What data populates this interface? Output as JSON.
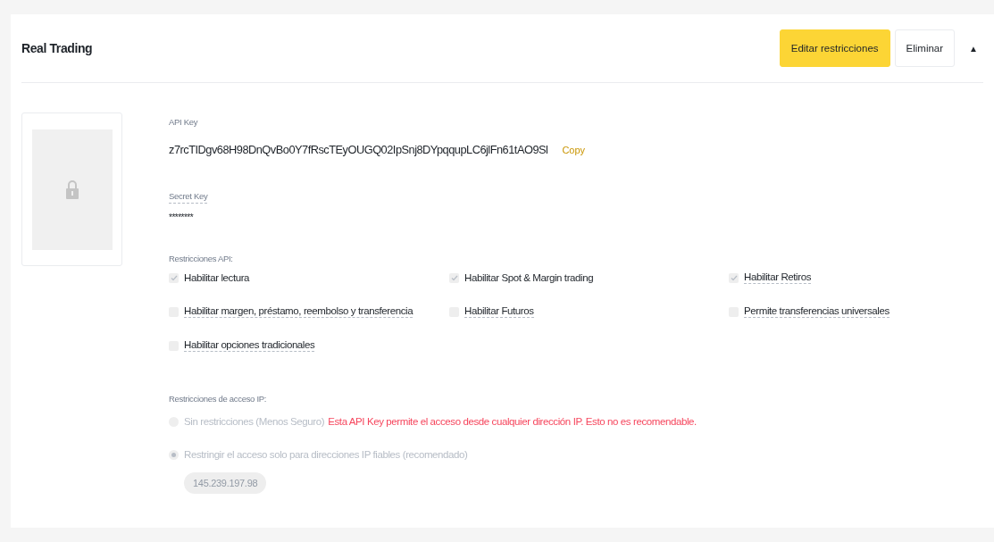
{
  "card": {
    "title": "Real Trading",
    "buttons": [
      {
        "label": "Editar restricciones",
        "kind": "primary"
      },
      {
        "label": "Eliminar",
        "kind": "secondary"
      }
    ],
    "toggle": "▲",
    "expanded": true
  },
  "api_key": {
    "label": "API Key",
    "value": "z7rcTIDgv68H98DnQvBo0Y7fRscTEyOUGQ02IpSnj8DYpqqupLC6jlFn61tAO9Sl",
    "copy": "Copy"
  },
  "secret_key": {
    "label": "Secret Key",
    "value": "********"
  },
  "restrictions": {
    "label": "Restricciones API:",
    "options": [
      {
        "label": "Habilitar lectura",
        "checked": true,
        "tooltip": false
      },
      {
        "label": "Habilitar Spot & Margin trading",
        "checked": true,
        "tooltip": false
      },
      {
        "label": "Habilitar Retiros",
        "checked": true,
        "tooltip": true
      },
      {
        "label": "Habilitar margen, préstamo, reembolso y transferencia",
        "checked": false,
        "tooltip": true
      },
      {
        "label": "Habilitar Futuros",
        "checked": false,
        "tooltip": true
      },
      {
        "label": "Permite transferencias universales",
        "checked": false,
        "tooltip": true
      },
      {
        "label": "Habilitar opciones tradicionales",
        "checked": false,
        "tooltip": true
      }
    ]
  },
  "ip_access": {
    "label": "Restricciones de acceso IP:",
    "options": [
      {
        "label": "Sin restricciones (Menos Seguro)",
        "warning": "Esta API Key permite el acceso desde cualquier dirección IP. Esto no es recomendable.",
        "selected": false,
        "disabled": true
      },
      {
        "label": "Restringir el acceso solo para direcciones IP fiables (recomendado)",
        "selected": true,
        "disabled": true
      }
    ],
    "ips": [
      "145.239.197.98"
    ]
  }
}
